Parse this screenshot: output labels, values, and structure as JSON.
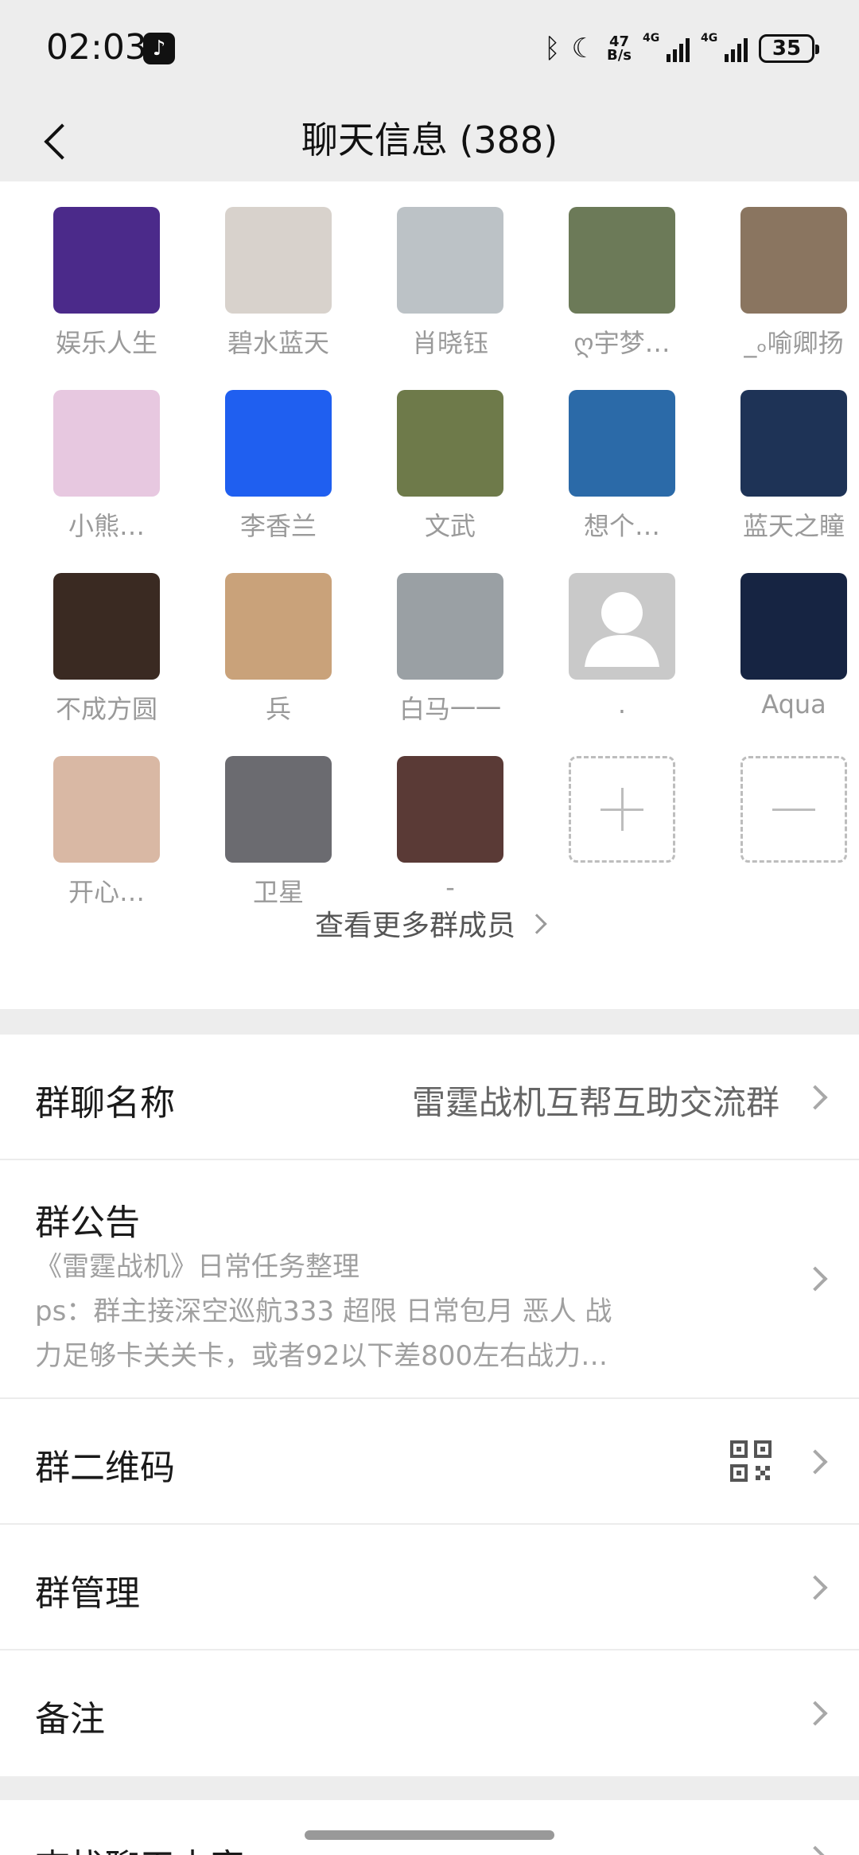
{
  "status": {
    "time": "02:03",
    "net_speed_top": "47",
    "net_speed_bottom": "B/s",
    "sig1": "4G",
    "sig2": "4G",
    "battery": "35"
  },
  "header": {
    "title": "聊天信息 (388)"
  },
  "members": [
    {
      "name": "娱乐人生",
      "color": "#4b2a8a"
    },
    {
      "name": "碧水蓝天",
      "color": "#d8d2cc"
    },
    {
      "name": "肖晓钰",
      "color": "#bcc2c6"
    },
    {
      "name": "ღ宇梦…",
      "color": "#6c7a58"
    },
    {
      "name": "_ₒ喻卿扬",
      "color": "#8a7560"
    },
    {
      "name": "小熊…",
      "color": "#e7c8e0"
    },
    {
      "name": "李香兰",
      "color": "#1f5ff0"
    },
    {
      "name": "文武",
      "color": "#6e7a4a"
    },
    {
      "name": "想个…",
      "color": "#2b6aa8"
    },
    {
      "name": "蓝天之瞳",
      "color": "#1e3356"
    },
    {
      "name": "不成方圆",
      "color": "#3a2a22"
    },
    {
      "name": "兵",
      "color": "#c9a27a"
    },
    {
      "name": "白马一一",
      "color": "#9aa0a4"
    },
    {
      "name": ".",
      "color": "#c9c9c9"
    },
    {
      "name": "Aqua",
      "color": "#162442"
    },
    {
      "name": "开心…",
      "color": "#d9b8a4"
    },
    {
      "name": "卫星",
      "color": "#6b6b70"
    },
    {
      "name": "-",
      "color": "#5a3a36"
    }
  ],
  "more_members": "查看更多群成员",
  "settings": {
    "group_name_label": "群聊名称",
    "group_name_value": "雷霆战机互帮互助交流群",
    "notice_label": "群公告",
    "notice_line1": "《雷霆战机》日常任务整理",
    "notice_line2": "ps：群主接深空巡航333 超限 日常包月 恶人 战",
    "notice_line3": "力足够卡关关卡，或者92以下差800左右战力…",
    "qr_label": "群二维码",
    "manage_label": "群管理",
    "remark_label": "备注",
    "search_label": "查找聊天内容"
  }
}
